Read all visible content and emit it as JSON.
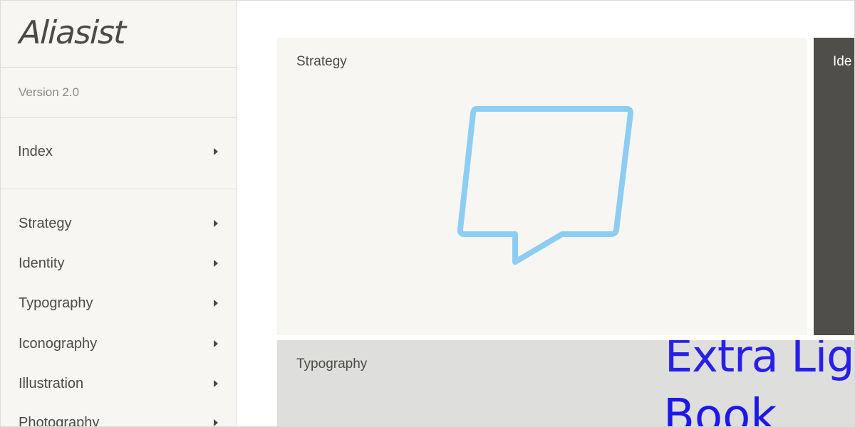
{
  "brand": {
    "logo_text": "Aliasist"
  },
  "sidebar": {
    "version": "Version 2.0",
    "index_label": "Index",
    "items": [
      {
        "label": "Strategy"
      },
      {
        "label": "Identity"
      },
      {
        "label": "Typography"
      },
      {
        "label": "Iconography"
      },
      {
        "label": "Illustration"
      },
      {
        "label": "Photography"
      }
    ]
  },
  "main": {
    "cards": {
      "strategy": {
        "title": "Strategy",
        "icon": "speech-bubble-icon",
        "icon_color": "#8ecdf2"
      },
      "identity": {
        "title": "Ide",
        "bg": "#4f4e4a"
      },
      "typography": {
        "title": "Typography",
        "samples": [
          "Extra Lig",
          "Book"
        ],
        "sample_color": "#1f16e8"
      }
    }
  }
}
